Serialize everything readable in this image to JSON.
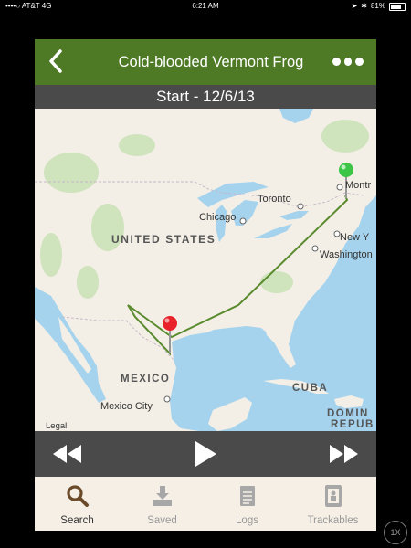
{
  "status_bar": {
    "carrier": "••••○ AT&T  4G",
    "time": "6:21 AM",
    "battery": "81%"
  },
  "navbar": {
    "title": "Cold-blooded Vermont Frog",
    "back_icon": "chevron-left-icon",
    "more_icon": "ellipsis-icon"
  },
  "subtitle": "Start - 12/6/13",
  "map": {
    "labels": {
      "united_states": "UNITED STATES",
      "mexico": "MEXICO",
      "cuba": "CUBA",
      "dominican_republic_1": "DOMIN",
      "dominican_republic_2": "REPUB",
      "chicago": "Chicago",
      "toronto": "Toronto",
      "montreal": "Montr",
      "new_york": "New Y",
      "washington": "Washington",
      "mexico_city": "Mexico City",
      "legal": "Legal"
    },
    "route_color": "#5a8b2e",
    "start_pin_color": "#3dc548",
    "end_pin_color": "#e8232a"
  },
  "controls": {
    "rewind_icon": "rewind-icon",
    "play_icon": "play-icon",
    "fast_forward_icon": "fast-forward-icon"
  },
  "tabs": [
    {
      "label": "Search",
      "icon": "search-icon",
      "active": true
    },
    {
      "label": "Saved",
      "icon": "download-icon",
      "active": false
    },
    {
      "label": "Logs",
      "icon": "notepad-icon",
      "active": false
    },
    {
      "label": "Trackables",
      "icon": "trackable-tag-icon",
      "active": false
    }
  ],
  "zoom_badge": "1X",
  "colors": {
    "brand_green": "#4e7a26",
    "dark_bar": "#4a4a4a",
    "tab_bg": "#f6efe6",
    "active_icon": "#6b4a2a"
  }
}
